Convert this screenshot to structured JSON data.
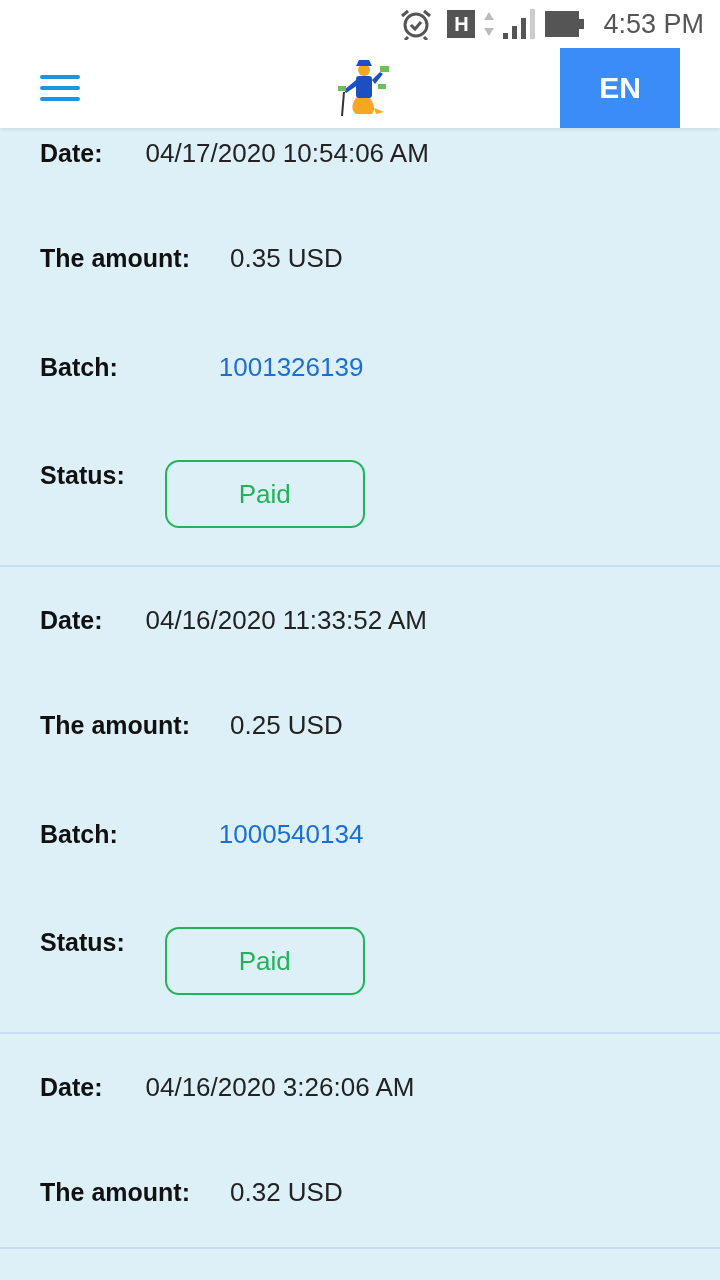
{
  "status_bar": {
    "time": "4:53 PM",
    "network": "H"
  },
  "header": {
    "language_button": "EN"
  },
  "payments": [
    {
      "date_label": "Date:",
      "date": "04/17/2020 10:54:06 AM",
      "amount_label": "The amount:",
      "amount": "0.35 USD",
      "batch_label": "Batch:",
      "batch": "1001326139",
      "status_label": "Status:",
      "status": "Paid"
    },
    {
      "date_label": "Date:",
      "date": "04/16/2020 11:33:52 AM",
      "amount_label": "The amount:",
      "amount": "0.25 USD",
      "batch_label": "Batch:",
      "batch": "1000540134",
      "status_label": "Status:",
      "status": "Paid"
    },
    {
      "date_label": "Date:",
      "date": "04/16/2020 3:26:06 AM",
      "amount_label": "The amount:",
      "amount": "0.32 USD"
    }
  ]
}
